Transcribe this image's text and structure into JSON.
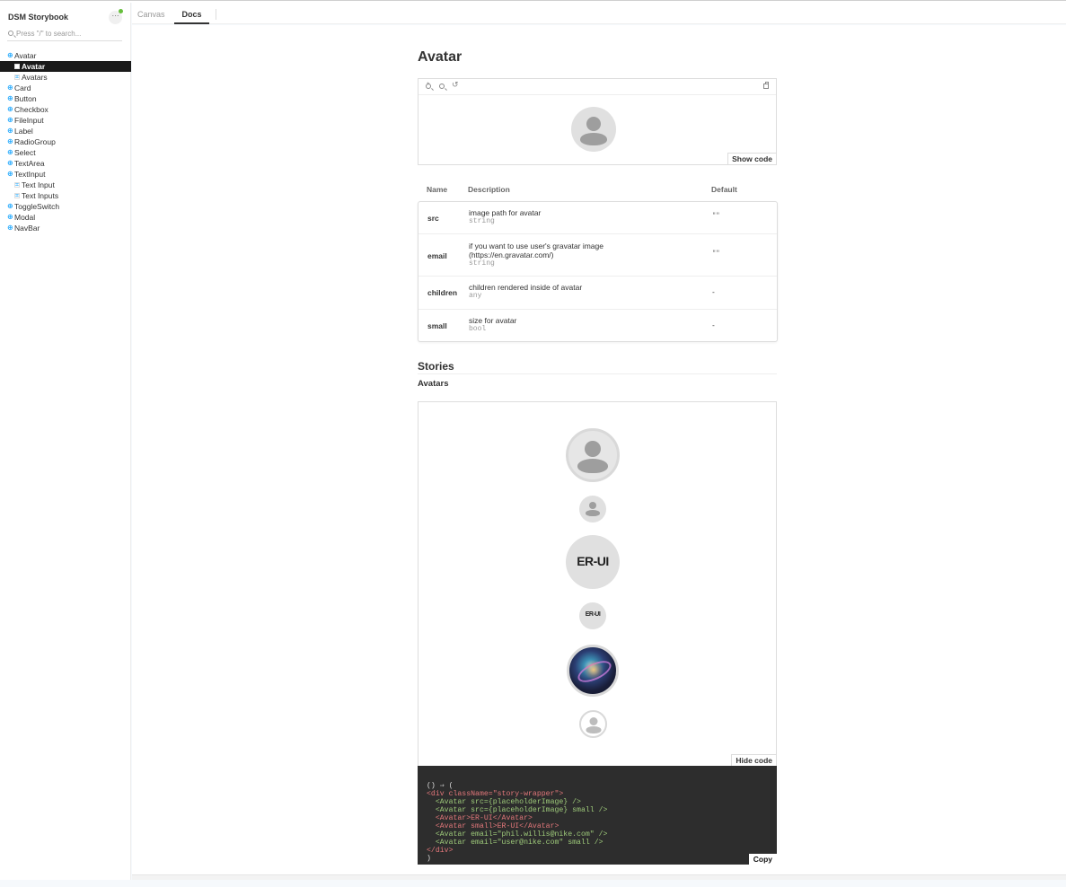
{
  "sidebar": {
    "brand": "DSM Storybook",
    "menu_label": "···",
    "search_placeholder": "Press \"/\" to search...",
    "items": [
      {
        "label": "Avatar",
        "kind": "component"
      },
      {
        "label": "Avatar",
        "kind": "story",
        "active": true
      },
      {
        "label": "Avatars",
        "kind": "story"
      },
      {
        "label": "Card",
        "kind": "component"
      },
      {
        "label": "Button",
        "kind": "component"
      },
      {
        "label": "Checkbox",
        "kind": "component"
      },
      {
        "label": "FileInput",
        "kind": "component"
      },
      {
        "label": "Label",
        "kind": "component"
      },
      {
        "label": "RadioGroup",
        "kind": "component"
      },
      {
        "label": "Select",
        "kind": "component"
      },
      {
        "label": "TextArea",
        "kind": "component"
      },
      {
        "label": "TextInput",
        "kind": "component"
      },
      {
        "label": "Text Input",
        "kind": "story"
      },
      {
        "label": "Text Inputs",
        "kind": "story"
      },
      {
        "label": "ToggleSwitch",
        "kind": "component"
      },
      {
        "label": "Modal",
        "kind": "component"
      },
      {
        "label": "NavBar",
        "kind": "component"
      }
    ]
  },
  "tabs": [
    {
      "label": "Canvas",
      "active": false
    },
    {
      "label": "Docs",
      "active": true
    }
  ],
  "doc": {
    "title": "Avatar",
    "preview": {
      "show_code_label": "Show code"
    },
    "props_table": {
      "headers": [
        "Name",
        "Description",
        "Default"
      ],
      "rows": [
        {
          "name": "src",
          "description": "image path for avatar",
          "type": "string",
          "default": "\"\""
        },
        {
          "name": "email",
          "description": "if you want to use user's gravatar image (https://en.gravatar.com/)",
          "type": "string",
          "default": "\"\""
        },
        {
          "name": "children",
          "description": "children rendered inside of avatar",
          "type": "any",
          "default": "-"
        },
        {
          "name": "small",
          "description": "size for avatar",
          "type": "bool",
          "default": "-"
        }
      ]
    },
    "stories_heading": "Stories",
    "story_title": "Avatars",
    "story": {
      "initials": "ER-UI",
      "hide_code_label": "Hide code",
      "code_lines": [
        "() ⇒ (",
        "<div className=\"story-wrapper\">",
        "  <Avatar src={placeholderImage} />",
        "  <Avatar src={placeholderImage} small />",
        "  <Avatar>ER-UI</Avatar>",
        "  <Avatar small>ER-UI</Avatar>",
        "  <Avatar email=\"phil.willis@nike.com\" />",
        "  <Avatar email=\"user@nike.com\" small />",
        "</div>",
        ")"
      ],
      "copy_label": "Copy"
    }
  },
  "colors": {
    "accent": "#1ea7fd",
    "active_bg": "#1a1a1a",
    "status_dot": "#66bf3c",
    "code_bg": "#2d2d2d"
  }
}
